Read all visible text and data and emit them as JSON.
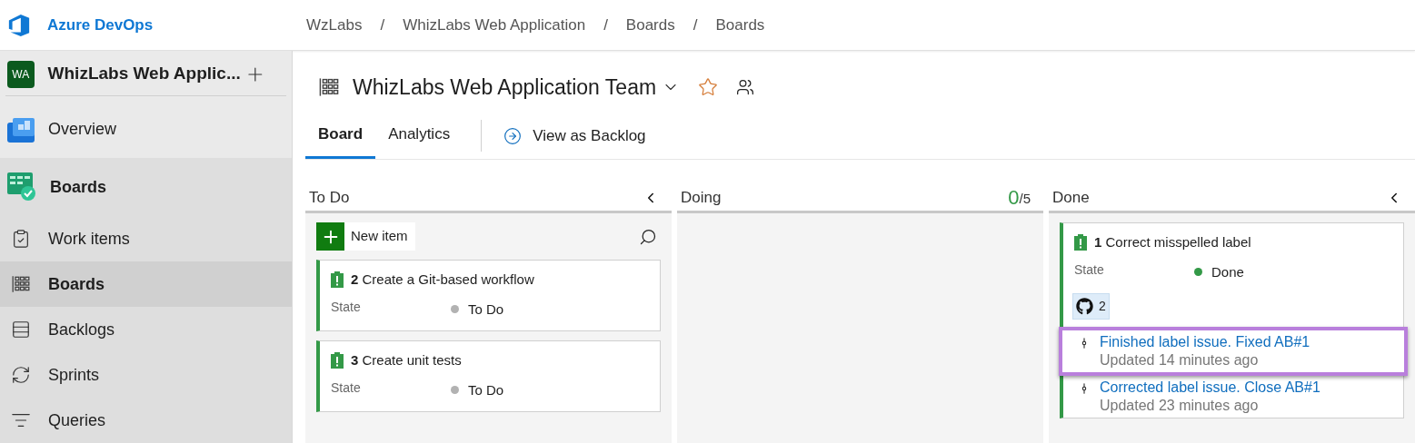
{
  "header": {
    "product": "Azure DevOps",
    "breadcrumbs": [
      "WzLabs",
      "/",
      "WhizLabs Web Application",
      "/",
      "Boards",
      "/",
      "Boards"
    ]
  },
  "sidebar": {
    "project": {
      "initials": "WA",
      "name": "WhizLabs Web Applic..."
    },
    "items": [
      {
        "label": "Overview"
      },
      {
        "label": "Boards",
        "children": [
          {
            "label": "Work items",
            "selected": false
          },
          {
            "label": "Boards",
            "selected": true
          },
          {
            "label": "Backlogs",
            "selected": false
          },
          {
            "label": "Sprints",
            "selected": false
          },
          {
            "label": "Queries",
            "selected": false
          }
        ]
      }
    ]
  },
  "team": {
    "name": "WhizLabs Web Application Team",
    "favorite": false
  },
  "tabs": [
    {
      "label": "Board",
      "selected": true
    },
    {
      "label": "Analytics",
      "selected": false
    }
  ],
  "view_link": "View as Backlog",
  "columns": [
    {
      "title": "To Do",
      "collapsible": true,
      "new_item": "New item",
      "cards": [
        {
          "id": "2",
          "title": "Create a Git-based workflow",
          "field": "State",
          "state": "To Do",
          "color": "#b2b2b2"
        },
        {
          "id": "3",
          "title": "Create unit tests",
          "field": "State",
          "state": "To Do",
          "color": "#b2b2b2"
        }
      ]
    },
    {
      "title": "Doing",
      "count": "0",
      "limit": "/5",
      "collapsible": false
    },
    {
      "title": "Done",
      "collapsible": true,
      "cards": [
        {
          "id": "1",
          "title": "Correct misspelled label",
          "field": "State",
          "state": "Done",
          "color": "#339947",
          "links": "2",
          "commits": [
            {
              "message": "Finished label issue. Fixed AB#1",
              "updated": "Updated 14 minutes ago",
              "selected": true
            },
            {
              "message": "Corrected label issue. Close AB#1",
              "updated": "Updated 23 minutes ago",
              "selected": false
            }
          ]
        }
      ]
    }
  ]
}
